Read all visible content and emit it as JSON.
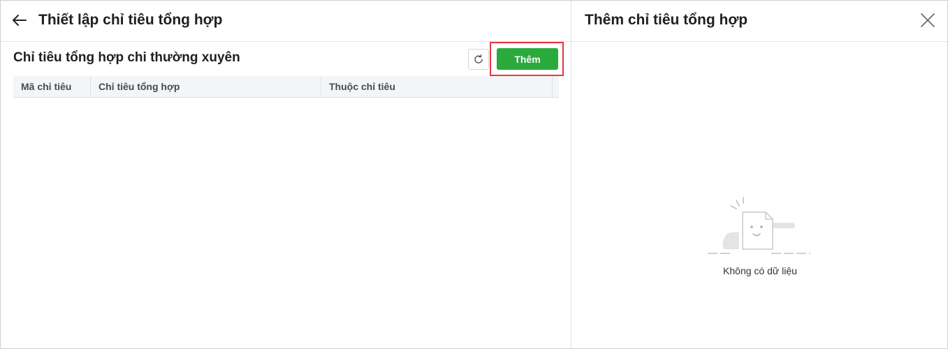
{
  "left_panel": {
    "title": "Thiết lập chỉ tiêu tổng hợp",
    "section_title": "Chỉ tiêu tổng hợp chi thường xuyên",
    "add_button_label": "Thêm",
    "table": {
      "columns": [
        "Mã chỉ tiêu",
        "Chỉ tiêu tổng hợp",
        "Thuộc chỉ tiêu"
      ],
      "rows": []
    }
  },
  "right_panel": {
    "title": "Thêm chỉ tiêu tổng hợp",
    "empty_text": "Không có dữ liệu"
  },
  "icons": {
    "back": "arrow-left-icon",
    "refresh": "refresh-icon",
    "close": "close-icon",
    "empty": "empty-document-icon"
  },
  "colors": {
    "primary": "#2aaa3c",
    "highlight": "#e4373f",
    "header_bg": "#f4f5f8"
  }
}
